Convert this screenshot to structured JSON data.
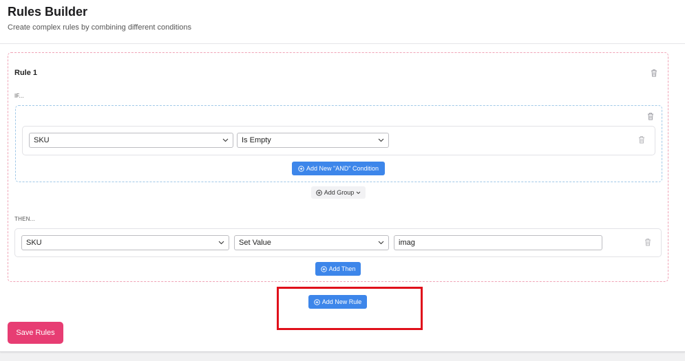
{
  "header": {
    "title": "Rules Builder",
    "subtitle": "Create complex rules by combining different conditions"
  },
  "rule": {
    "title": "Rule 1",
    "if_label": "IF...",
    "then_label": "THEN...",
    "condition": {
      "field": "SKU",
      "operator": "Is Empty"
    },
    "add_and_condition_label": "Add New \"AND\" Condition",
    "add_group_label": "Add Group",
    "action": {
      "field": "SKU",
      "action_type": "Set Value",
      "value": "imag"
    },
    "add_then_label": "Add Then"
  },
  "add_new_rule_label": "Add New Rule",
  "save_rules_label": "Save Rules",
  "colors": {
    "primary_blue": "#3d86ea",
    "save_pink": "#e73d73",
    "highlight_red": "#e0101b"
  }
}
